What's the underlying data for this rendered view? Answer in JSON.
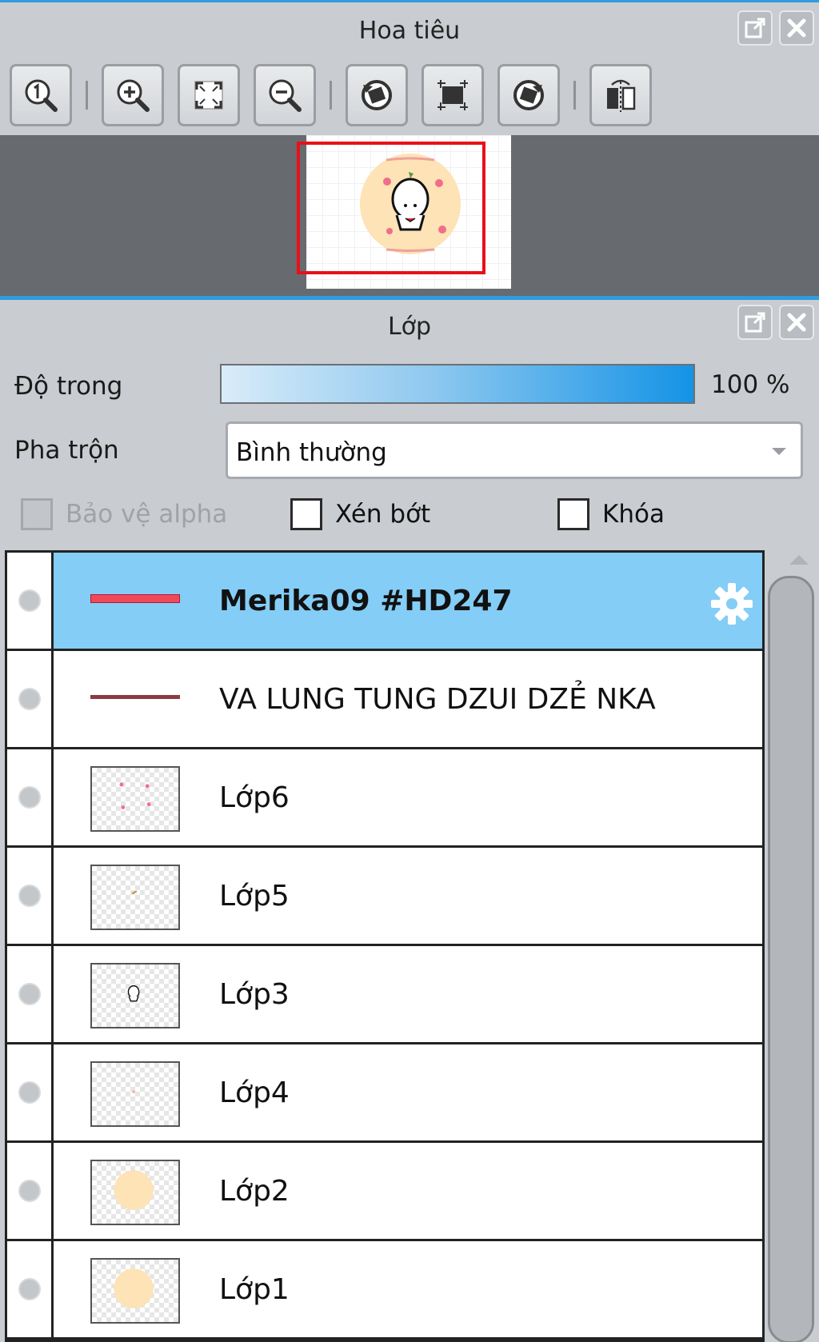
{
  "navigator": {
    "title": "Hoa tiêu",
    "title_buttons": [
      "popout-icon",
      "close-icon"
    ],
    "tools": [
      {
        "icon": "actual-size-icon"
      },
      {
        "icon": "zoom-in-icon"
      },
      {
        "icon": "fit-screen-icon"
      },
      {
        "icon": "zoom-out-icon"
      },
      {
        "icon": "rotate-left-icon"
      },
      {
        "icon": "reset-rotation-icon"
      },
      {
        "icon": "rotate-right-icon"
      },
      {
        "icon": "flip-horizontal-icon"
      }
    ],
    "view_rect_color": "#e8101a"
  },
  "layers": {
    "title": "Lớp",
    "opacity_label": "Độ trong",
    "opacity_value": "100 %",
    "opacity_level": 1.0,
    "blend_label": "Pha trộn",
    "blend_value": "Bình thường",
    "protect_alpha_label": "Bảo vệ alpha",
    "clip_label": "Xén bớt",
    "lock_label": "Khóa",
    "items": [
      {
        "name": "Merika09 #HD247",
        "thumb": "text-red"
      },
      {
        "name": "VA LUNG TUNG DZUI DZẺ NKA",
        "thumb": "text-line"
      },
      {
        "name": "Lớp6",
        "thumb": "hearts"
      },
      {
        "name": "Lớp5",
        "thumb": "sprout"
      },
      {
        "name": "Lớp3",
        "thumb": "character"
      },
      {
        "name": "Lớp4",
        "thumb": "small-dot"
      },
      {
        "name": "Lớp2",
        "thumb": "circle"
      },
      {
        "name": "Lớp1",
        "thumb": "circle"
      }
    ],
    "selected_color": "#84cdf6",
    "opacity_accent": "#1593e6"
  }
}
